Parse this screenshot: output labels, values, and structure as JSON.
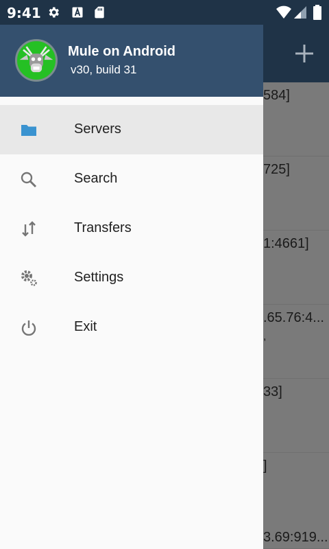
{
  "status_bar": {
    "time": "9:41",
    "icons": [
      "gear-icon",
      "font-icon",
      "sd-card-icon",
      "wifi-icon",
      "signal-icon",
      "battery-icon"
    ]
  },
  "app": {
    "toolbar_action": "add-icon",
    "servers": [
      {
        "address": "584]",
        "sub": ""
      },
      {
        "address": "725]",
        "sub": ""
      },
      {
        "address": "1:4661]",
        "sub": ""
      },
      {
        "address": ".65.76:4...",
        "sub": ","
      },
      {
        "address": "33]",
        "sub": ""
      },
      {
        "address": "]",
        "sub": ""
      },
      {
        "address": "3.69:919...",
        "sub": ""
      }
    ]
  },
  "drawer": {
    "app_name": "Mule on Android",
    "version": "v30,  build 31",
    "items": [
      {
        "label": "Servers",
        "icon": "folder-icon",
        "active": true
      },
      {
        "label": "Search",
        "icon": "search-icon",
        "active": false
      },
      {
        "label": "Transfers",
        "icon": "transfer-arrows-icon",
        "active": false
      },
      {
        "label": "Settings",
        "icon": "gears-icon",
        "active": false
      },
      {
        "label": "Exit",
        "icon": "power-icon",
        "active": false
      }
    ]
  },
  "colors": {
    "toolbar": "#1f3347",
    "drawer_header": "#34506e",
    "accent_folder": "#3a93d0",
    "scrim": "#7a7a7a"
  }
}
